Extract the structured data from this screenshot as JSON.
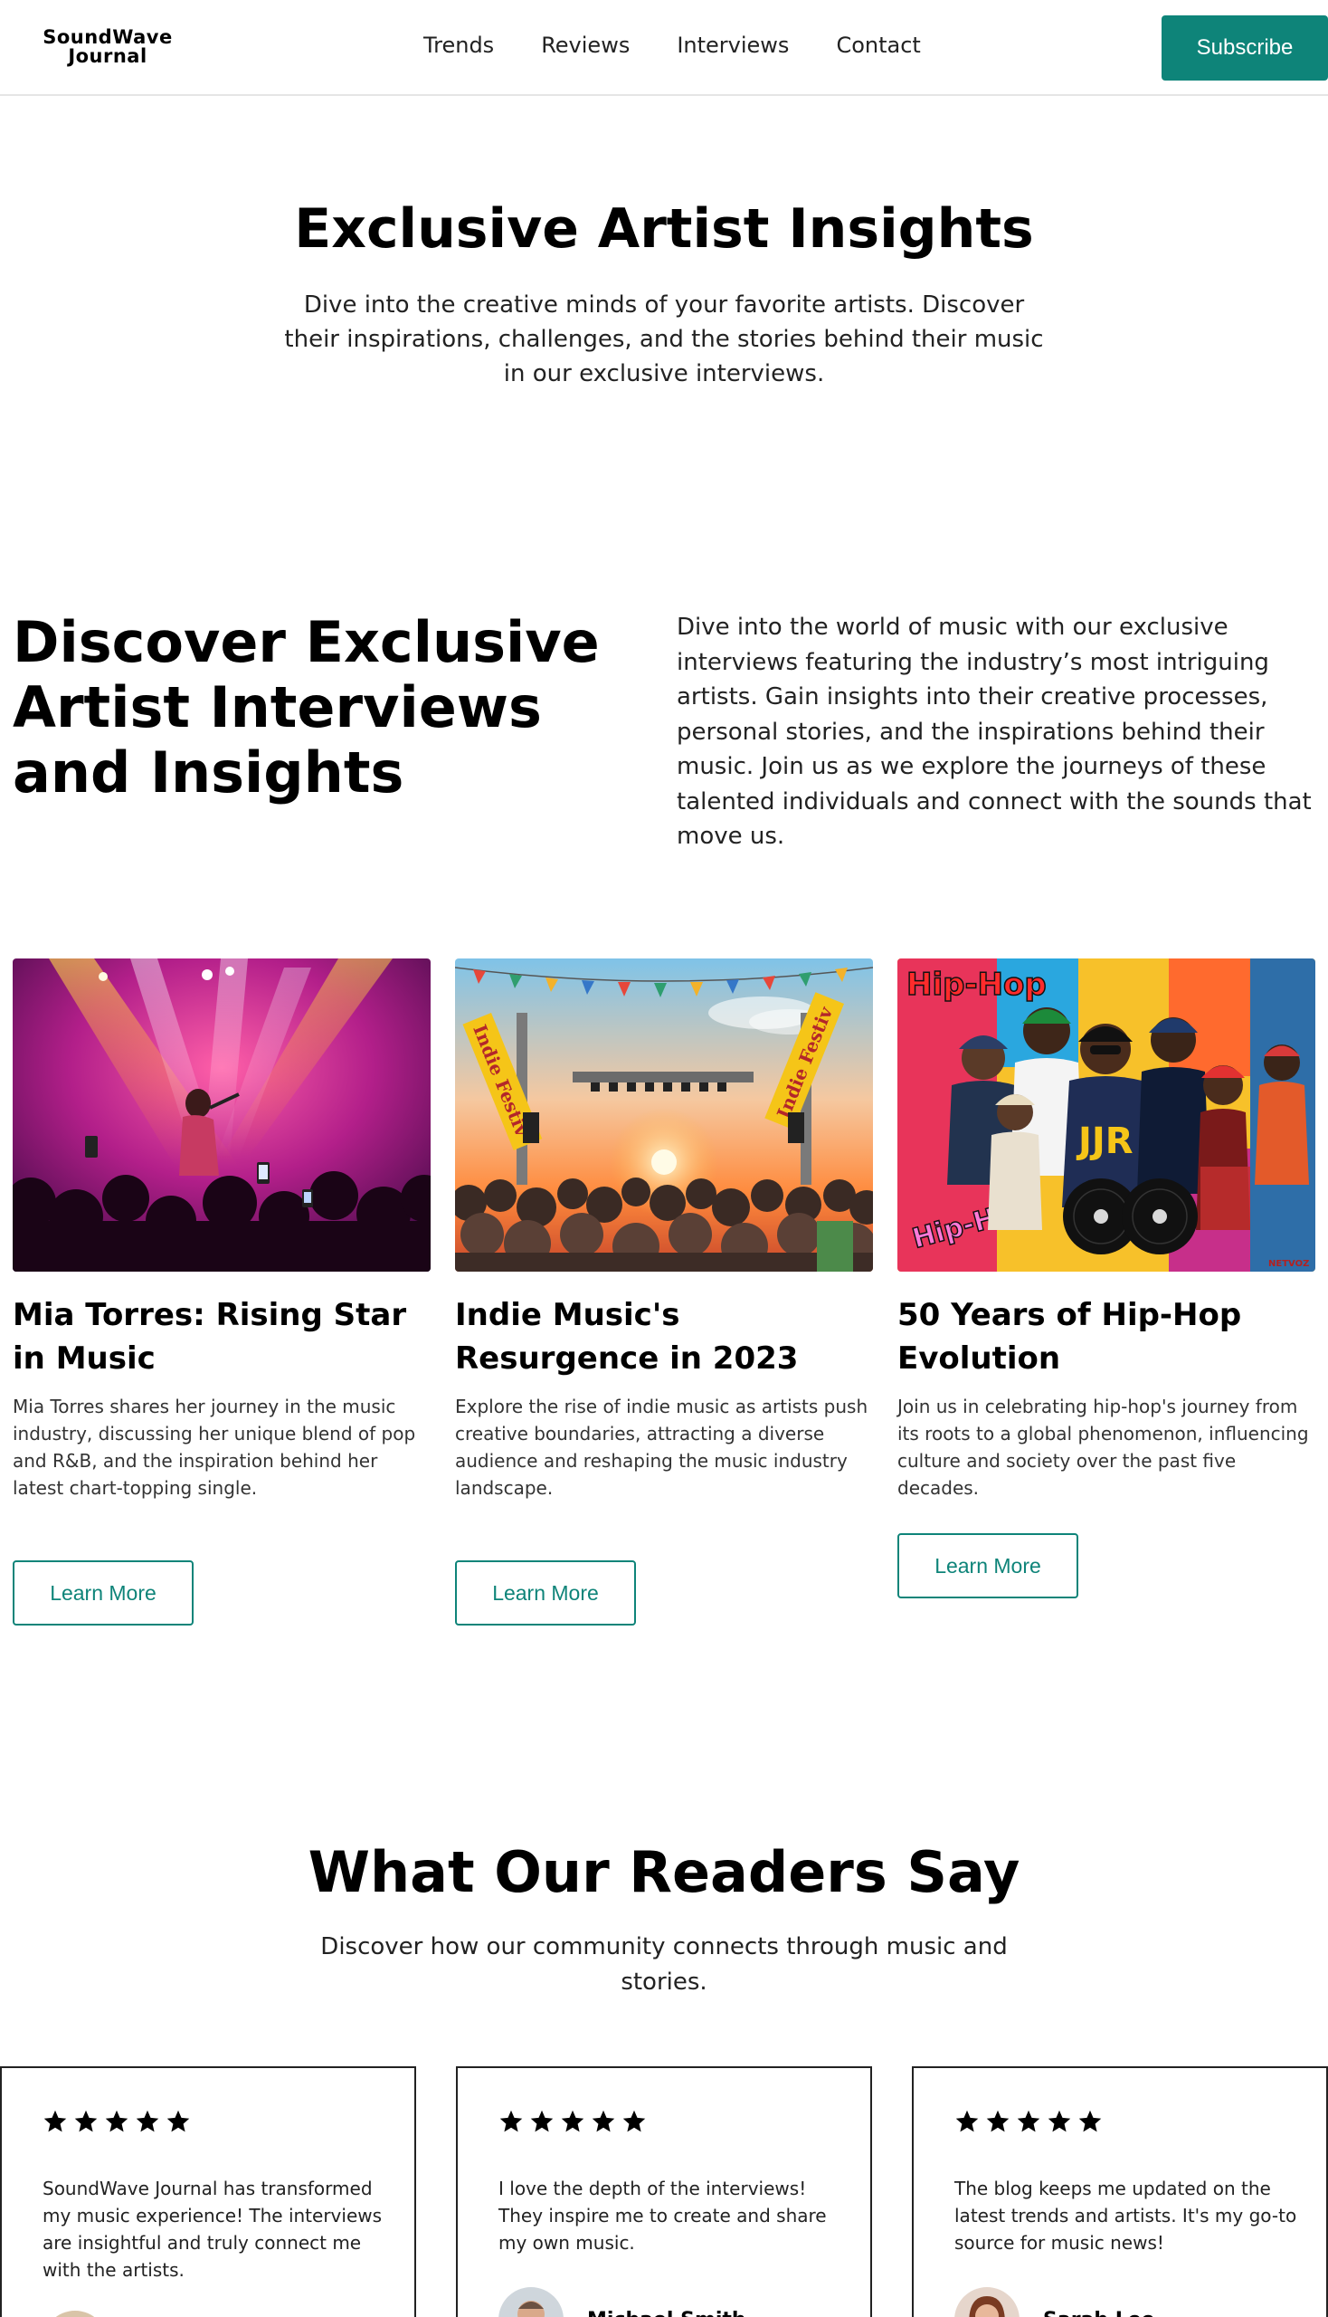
{
  "nav": {
    "logo_line1": "SoundWave",
    "logo_line2": "Journal",
    "links": [
      "Trends",
      "Reviews",
      "Interviews",
      "Contact"
    ],
    "subscribe": "Subscribe"
  },
  "hero": {
    "title": "Exclusive Artist Insights",
    "subtitle": "Dive into the creative minds of your favorite artists. Discover their inspirations, challenges, and the stories behind their music in our exclusive interviews."
  },
  "intro": {
    "title": "Discover Exclusive Artist Interviews and Insights",
    "text": "Dive into the world of music with our exclusive interviews featuring the industry’s most intriguing artists. Gain insights into their creative processes, personal stories, and the inspirations behind their music. Join us as we explore the journeys of these talented individuals and connect with the sounds that move us."
  },
  "cards": [
    {
      "title": "Mia Torres: Rising Star in Music",
      "text": "Mia Torres shares her journey in the music industry, discussing her unique blend of pop and R&B, and the inspiration behind her latest chart-topping single.",
      "button": "Learn More"
    },
    {
      "title": "Indie Music's Resurgence in 2023",
      "text": "Explore the rise of indie music as artists push creative boundaries, attracting a diverse audience and reshaping the music industry landscape.",
      "button": "Learn More",
      "banner_left": "Indie Festiv",
      "banner_right": "Indie Festiv"
    },
    {
      "title": "50 Years of Hip-Hop Evolution",
      "text": "Join us in celebrating hip-hop's journey from its roots to a global phenomenon, influencing culture and society over the past five decades.",
      "button": "Learn More",
      "graffiti_top": "Hip-Hop",
      "graffiti_bottom": "Hip-Hop"
    }
  ],
  "readers": {
    "title": "What Our Readers Say",
    "subtitle": "Discover how our community connects through music and stories."
  },
  "testimonials": [
    {
      "rating": 5,
      "text": "SoundWave Journal has transformed my music experience! The interviews are insightful and truly connect me with the artists.",
      "name": ""
    },
    {
      "rating": 5,
      "text": "I love the depth of the interviews! They inspire me to create and share my own music.",
      "name": "Michael Smith"
    },
    {
      "rating": 5,
      "text": "The blog keeps me updated on the latest trends and artists. It's my go-to source for music news!",
      "name": "Sarah Lee"
    }
  ],
  "colors": {
    "accent": "#0e8479",
    "text": "#111111",
    "border": "#222222"
  },
  "icons": [
    "star-icon",
    "avatar"
  ]
}
